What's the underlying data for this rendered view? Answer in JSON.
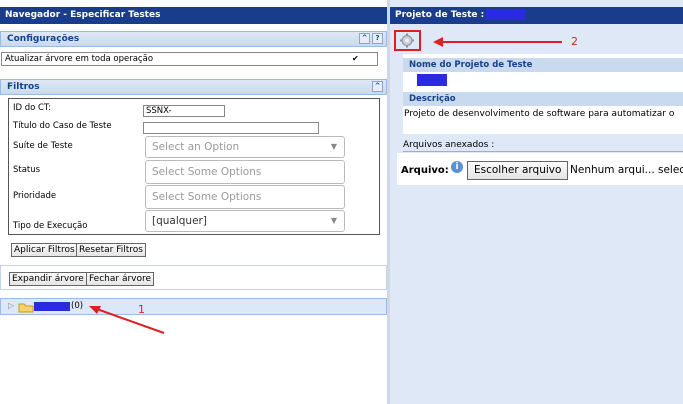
{
  "left_panel": {
    "title": "Navegador - Especificar Testes",
    "configuracoes": {
      "header": "Configurações",
      "collapse_icon": "^",
      "help_icon": "?",
      "option_label": "Atualizar árvore em toda operação",
      "option_checked": true,
      "check_mark": "✔"
    },
    "filtros": {
      "header": "Filtros",
      "collapse_icon": "^",
      "fields": {
        "id_label": "ID do CT:",
        "id_value": "SSNX-",
        "titulo_label": "Título do Caso de Teste",
        "suite_label": "Suíte de Teste",
        "suite_placeholder": "Select an Option",
        "status_label": "Status",
        "status_placeholder": "Select Some Options",
        "prioridade_label": "Prioridade",
        "prioridade_placeholder": "Select Some Options",
        "tipo_label": "Tipo de Execução",
        "tipo_value": "[qualquer]"
      },
      "apply_label": "Aplicar Filtros",
      "reset_label": "Resetar Filtros"
    },
    "tree": {
      "expand_label": "Expandir árvore",
      "collapse_label": "Fechar árvore",
      "root_suffix": "(0)"
    }
  },
  "right_panel": {
    "title": "Projeto de Teste :",
    "nome_header": "Nome do Projeto de Teste",
    "descricao_header": "Descrição",
    "descricao_text": "Projeto de desenvolvimento de software para automatizar o",
    "anexos_label": "Arquivos anexados :",
    "arquivo_label": "Arquivo:",
    "choose_button": "Escolher arquivo",
    "no_file_text": "Nenhum arqui... selec"
  },
  "annotations": {
    "marker_1": "1",
    "marker_2": "2",
    "color": "#e02020"
  },
  "colors": {
    "title_bar": "#1a3c8c",
    "redaction": "#2a2ae0",
    "panel_bg": "#dfe8f6"
  }
}
